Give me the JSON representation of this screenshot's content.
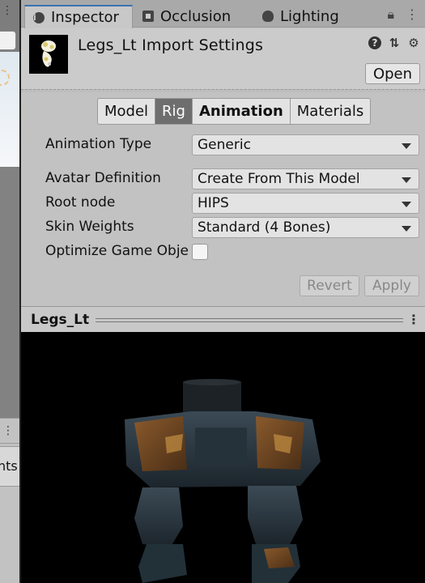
{
  "tabs": [
    {
      "label": "Inspector",
      "icon": "info-icon",
      "active": true
    },
    {
      "label": "Occlusion",
      "icon": "occlusion-icon",
      "active": false
    },
    {
      "label": "Lighting",
      "icon": "lightbulb-icon",
      "active": false
    }
  ],
  "header": {
    "title": "Legs_Lt Import Settings",
    "open_label": "Open",
    "icons": [
      "help-icon",
      "preset-icon",
      "gear-icon"
    ]
  },
  "rig_tabs": [
    {
      "label": "Model"
    },
    {
      "label": "Rig",
      "selected": true
    },
    {
      "label": "Animation"
    },
    {
      "label": "Materials"
    }
  ],
  "properties": {
    "animation_type": {
      "label": "Animation Type",
      "value": "Generic"
    },
    "avatar_definition": {
      "label": "Avatar Definition",
      "value": "Create From This Model"
    },
    "root_node": {
      "label": "Root node",
      "value": "HIPS"
    },
    "skin_weights": {
      "label": "Skin Weights",
      "value": "Standard (4 Bones)"
    },
    "optimize": {
      "label": "Optimize Game Obje",
      "checked": false
    }
  },
  "actions": {
    "revert_label": "Revert",
    "apply_label": "Apply"
  },
  "preview": {
    "title": "Legs_Lt"
  },
  "left_strip": {
    "fragment_text": "nts"
  }
}
